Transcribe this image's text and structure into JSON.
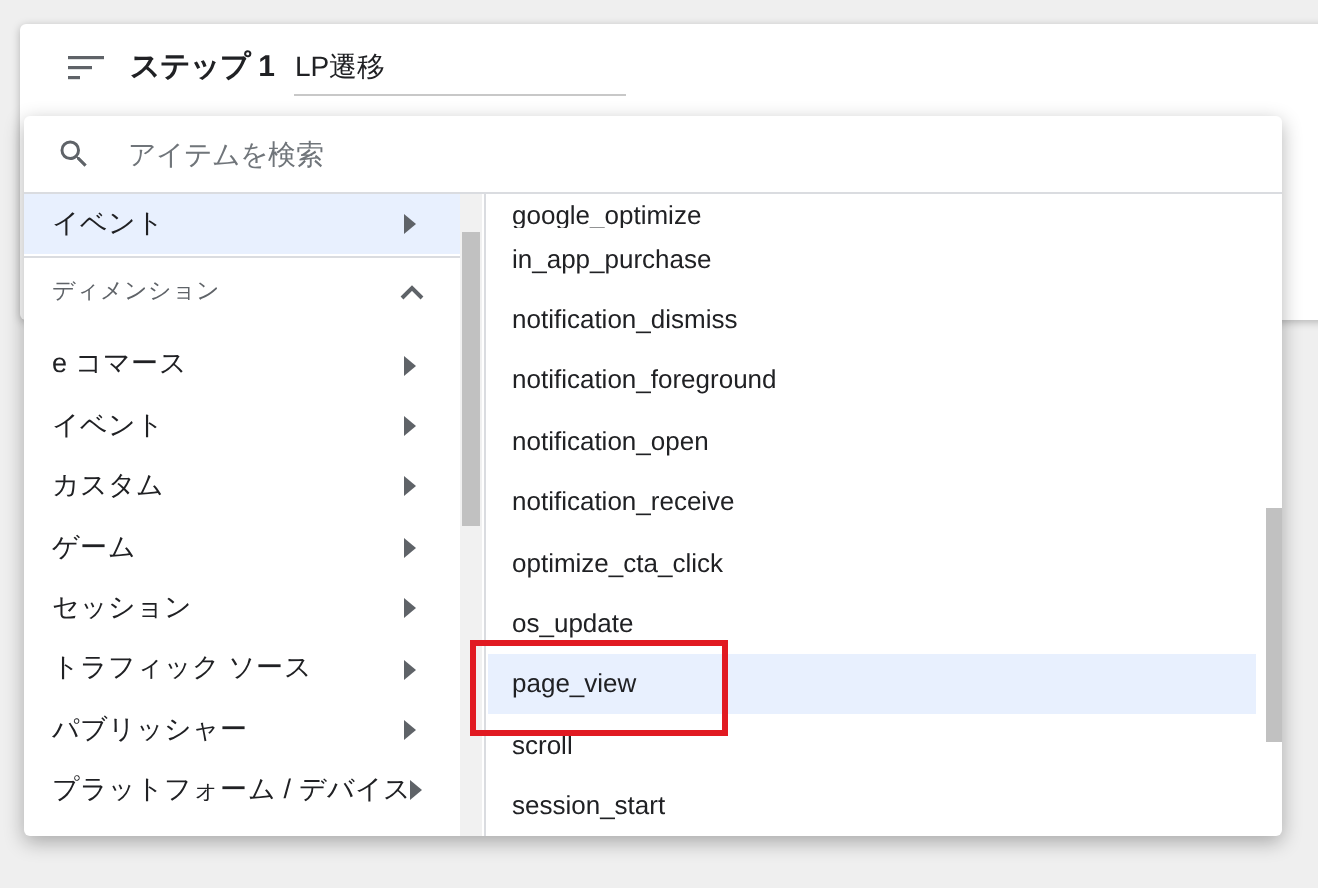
{
  "step": {
    "label": "ステップ 1",
    "value": "LP遷移"
  },
  "search": {
    "placeholder": "アイテムを検索"
  },
  "categories": {
    "top_items": [
      {
        "label": "イベント",
        "selected": true
      }
    ],
    "section": {
      "label": "ディメンション",
      "expanded": true
    },
    "items": [
      {
        "label": "e コマース",
        "selected": false
      },
      {
        "label": "イベント",
        "selected": false
      },
      {
        "label": "カスタム",
        "selected": false
      },
      {
        "label": "ゲーム",
        "selected": false
      },
      {
        "label": "セッション",
        "selected": false
      },
      {
        "label": "トラフィック ソース",
        "selected": false
      },
      {
        "label": "パブリッシャー",
        "selected": false
      },
      {
        "label": "プラットフォーム / デバイス",
        "selected": false
      }
    ]
  },
  "events": [
    {
      "label": "google_optimize",
      "selected": false,
      "annotated": false
    },
    {
      "label": "in_app_purchase",
      "selected": false,
      "annotated": false
    },
    {
      "label": "notification_dismiss",
      "selected": false,
      "annotated": false
    },
    {
      "label": "notification_foreground",
      "selected": false,
      "annotated": false
    },
    {
      "label": "notification_open",
      "selected": false,
      "annotated": false
    },
    {
      "label": "notification_receive",
      "selected": false,
      "annotated": false
    },
    {
      "label": "optimize_cta_click",
      "selected": false,
      "annotated": false
    },
    {
      "label": "os_update",
      "selected": false,
      "annotated": false
    },
    {
      "label": "page_view",
      "selected": true,
      "annotated": true
    },
    {
      "label": "scroll",
      "selected": false,
      "annotated": false
    },
    {
      "label": "session_start",
      "selected": false,
      "annotated": false
    }
  ]
}
